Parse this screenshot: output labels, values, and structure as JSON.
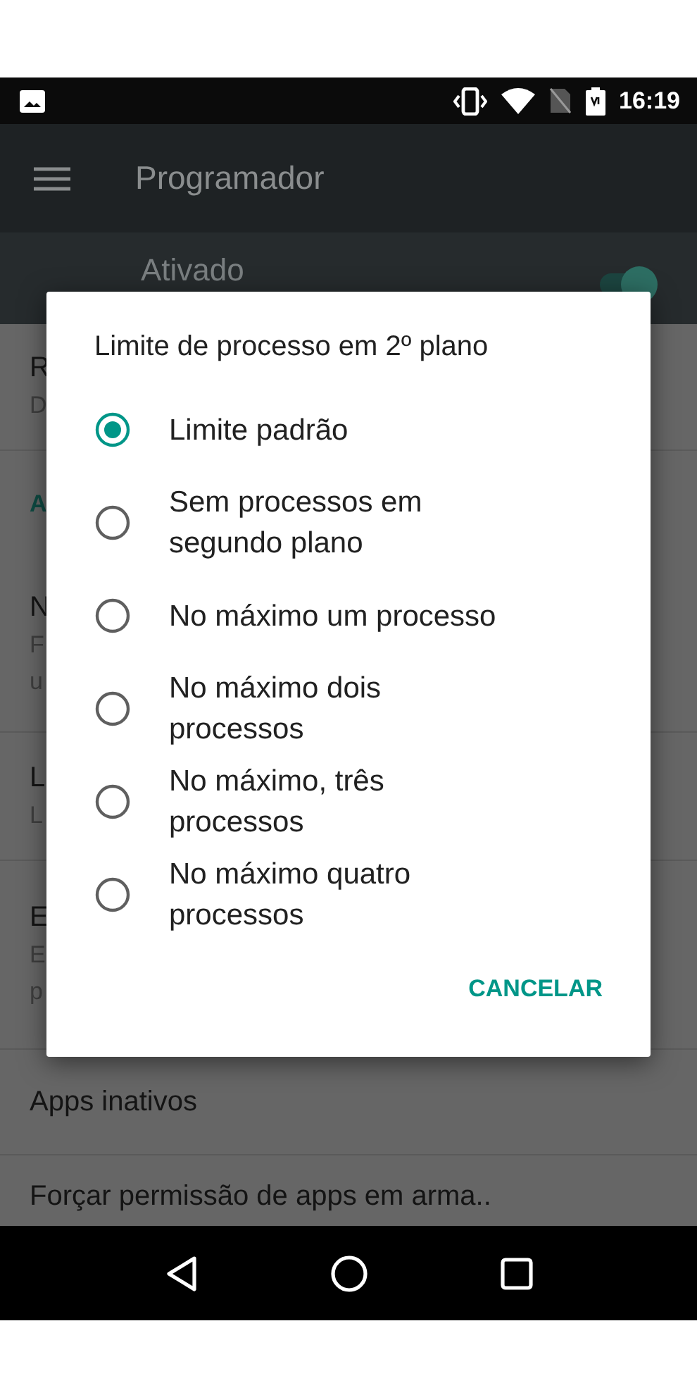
{
  "status_bar": {
    "time": "16:19"
  },
  "app_bar": {
    "title": "Programador"
  },
  "master_switch": {
    "label": "Ativado",
    "on": true
  },
  "background_rows": [
    {
      "kind": "item",
      "lines": [
        "R",
        "D"
      ]
    },
    {
      "kind": "header",
      "lines": [
        "A"
      ]
    },
    {
      "kind": "item",
      "lines": [
        "N",
        "F",
        "u"
      ]
    },
    {
      "kind": "item",
      "lines": [
        "L",
        "L"
      ]
    },
    {
      "kind": "item",
      "lines": [
        "E",
        "E",
        "p"
      ]
    },
    {
      "kind": "item",
      "lines": [
        "Apps inativos"
      ]
    },
    {
      "kind": "item",
      "lines": [
        "Forçar permissão de apps em arma.."
      ]
    }
  ],
  "dialog": {
    "title": "Limite de processo em 2º plano",
    "options": [
      {
        "label": "Limite padrão",
        "selected": true
      },
      {
        "label": "Sem processos em segundo plano",
        "selected": false
      },
      {
        "label": "No máximo um processo",
        "selected": false
      },
      {
        "label": "No máximo dois processos",
        "selected": false
      },
      {
        "label": "No máximo, três processos",
        "selected": false
      },
      {
        "label": "No máximo quatro processos",
        "selected": false
      }
    ],
    "buttons": [
      "CANCELAR"
    ]
  }
}
